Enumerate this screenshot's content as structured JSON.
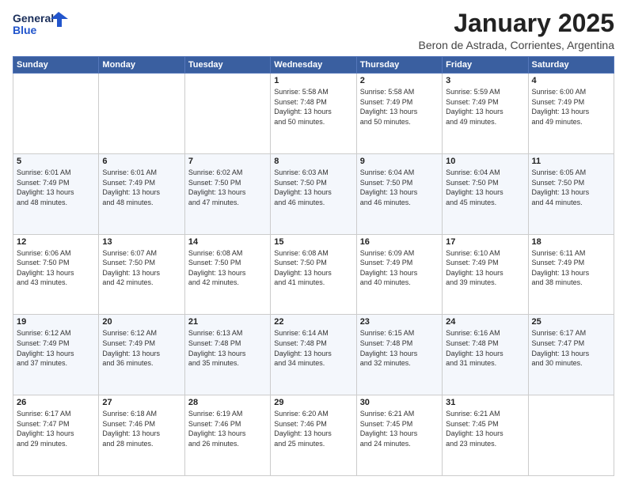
{
  "header": {
    "logo_line1": "General",
    "logo_line2": "Blue",
    "month": "January 2025",
    "location": "Beron de Astrada, Corrientes, Argentina"
  },
  "days_of_week": [
    "Sunday",
    "Monday",
    "Tuesday",
    "Wednesday",
    "Thursday",
    "Friday",
    "Saturday"
  ],
  "weeks": [
    [
      {
        "day": "",
        "text": ""
      },
      {
        "day": "",
        "text": ""
      },
      {
        "day": "",
        "text": ""
      },
      {
        "day": "1",
        "text": "Sunrise: 5:58 AM\nSunset: 7:48 PM\nDaylight: 13 hours\nand 50 minutes."
      },
      {
        "day": "2",
        "text": "Sunrise: 5:58 AM\nSunset: 7:49 PM\nDaylight: 13 hours\nand 50 minutes."
      },
      {
        "day": "3",
        "text": "Sunrise: 5:59 AM\nSunset: 7:49 PM\nDaylight: 13 hours\nand 49 minutes."
      },
      {
        "day": "4",
        "text": "Sunrise: 6:00 AM\nSunset: 7:49 PM\nDaylight: 13 hours\nand 49 minutes."
      }
    ],
    [
      {
        "day": "5",
        "text": "Sunrise: 6:01 AM\nSunset: 7:49 PM\nDaylight: 13 hours\nand 48 minutes."
      },
      {
        "day": "6",
        "text": "Sunrise: 6:01 AM\nSunset: 7:49 PM\nDaylight: 13 hours\nand 48 minutes."
      },
      {
        "day": "7",
        "text": "Sunrise: 6:02 AM\nSunset: 7:50 PM\nDaylight: 13 hours\nand 47 minutes."
      },
      {
        "day": "8",
        "text": "Sunrise: 6:03 AM\nSunset: 7:50 PM\nDaylight: 13 hours\nand 46 minutes."
      },
      {
        "day": "9",
        "text": "Sunrise: 6:04 AM\nSunset: 7:50 PM\nDaylight: 13 hours\nand 46 minutes."
      },
      {
        "day": "10",
        "text": "Sunrise: 6:04 AM\nSunset: 7:50 PM\nDaylight: 13 hours\nand 45 minutes."
      },
      {
        "day": "11",
        "text": "Sunrise: 6:05 AM\nSunset: 7:50 PM\nDaylight: 13 hours\nand 44 minutes."
      }
    ],
    [
      {
        "day": "12",
        "text": "Sunrise: 6:06 AM\nSunset: 7:50 PM\nDaylight: 13 hours\nand 43 minutes."
      },
      {
        "day": "13",
        "text": "Sunrise: 6:07 AM\nSunset: 7:50 PM\nDaylight: 13 hours\nand 42 minutes."
      },
      {
        "day": "14",
        "text": "Sunrise: 6:08 AM\nSunset: 7:50 PM\nDaylight: 13 hours\nand 42 minutes."
      },
      {
        "day": "15",
        "text": "Sunrise: 6:08 AM\nSunset: 7:50 PM\nDaylight: 13 hours\nand 41 minutes."
      },
      {
        "day": "16",
        "text": "Sunrise: 6:09 AM\nSunset: 7:49 PM\nDaylight: 13 hours\nand 40 minutes."
      },
      {
        "day": "17",
        "text": "Sunrise: 6:10 AM\nSunset: 7:49 PM\nDaylight: 13 hours\nand 39 minutes."
      },
      {
        "day": "18",
        "text": "Sunrise: 6:11 AM\nSunset: 7:49 PM\nDaylight: 13 hours\nand 38 minutes."
      }
    ],
    [
      {
        "day": "19",
        "text": "Sunrise: 6:12 AM\nSunset: 7:49 PM\nDaylight: 13 hours\nand 37 minutes."
      },
      {
        "day": "20",
        "text": "Sunrise: 6:12 AM\nSunset: 7:49 PM\nDaylight: 13 hours\nand 36 minutes."
      },
      {
        "day": "21",
        "text": "Sunrise: 6:13 AM\nSunset: 7:48 PM\nDaylight: 13 hours\nand 35 minutes."
      },
      {
        "day": "22",
        "text": "Sunrise: 6:14 AM\nSunset: 7:48 PM\nDaylight: 13 hours\nand 34 minutes."
      },
      {
        "day": "23",
        "text": "Sunrise: 6:15 AM\nSunset: 7:48 PM\nDaylight: 13 hours\nand 32 minutes."
      },
      {
        "day": "24",
        "text": "Sunrise: 6:16 AM\nSunset: 7:48 PM\nDaylight: 13 hours\nand 31 minutes."
      },
      {
        "day": "25",
        "text": "Sunrise: 6:17 AM\nSunset: 7:47 PM\nDaylight: 13 hours\nand 30 minutes."
      }
    ],
    [
      {
        "day": "26",
        "text": "Sunrise: 6:17 AM\nSunset: 7:47 PM\nDaylight: 13 hours\nand 29 minutes."
      },
      {
        "day": "27",
        "text": "Sunrise: 6:18 AM\nSunset: 7:46 PM\nDaylight: 13 hours\nand 28 minutes."
      },
      {
        "day": "28",
        "text": "Sunrise: 6:19 AM\nSunset: 7:46 PM\nDaylight: 13 hours\nand 26 minutes."
      },
      {
        "day": "29",
        "text": "Sunrise: 6:20 AM\nSunset: 7:46 PM\nDaylight: 13 hours\nand 25 minutes."
      },
      {
        "day": "30",
        "text": "Sunrise: 6:21 AM\nSunset: 7:45 PM\nDaylight: 13 hours\nand 24 minutes."
      },
      {
        "day": "31",
        "text": "Sunrise: 6:21 AM\nSunset: 7:45 PM\nDaylight: 13 hours\nand 23 minutes."
      },
      {
        "day": "",
        "text": ""
      }
    ]
  ]
}
